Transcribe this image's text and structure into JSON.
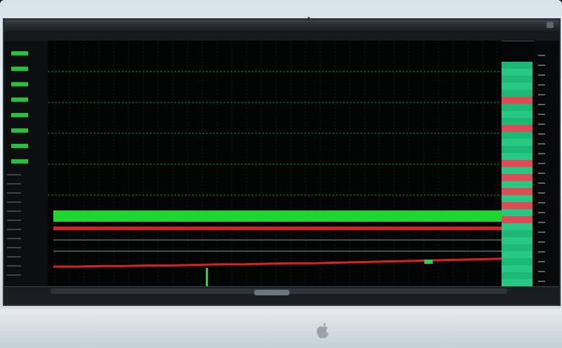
{
  "window": {
    "title": "",
    "colors": {
      "background": "#030404",
      "grid": "#1f7a3a",
      "green_band": "#1fd52f",
      "red_line": "#e1201c",
      "data_column": "#20c07a"
    }
  },
  "left_panel": {
    "rows": [
      {
        "label": "",
        "value": ""
      },
      {
        "label": "",
        "value": ""
      },
      {
        "label": "",
        "value": ""
      },
      {
        "label": "",
        "value": ""
      },
      {
        "label": "",
        "value": ""
      },
      {
        "label": "",
        "value": ""
      },
      {
        "label": "",
        "value": ""
      },
      {
        "label": "",
        "value": ""
      }
    ]
  },
  "chart_data": {
    "type": "line",
    "title": "",
    "xlabel": "",
    "ylabel": "",
    "grid": true,
    "series": [
      {
        "color": "#1fd52f",
        "values": [
          1,
          1,
          1,
          1,
          1,
          1,
          1,
          1,
          1,
          1,
          1,
          1,
          1,
          1,
          1,
          1,
          1,
          1,
          1,
          1
        ]
      },
      {
        "color": "#e1201c",
        "values": [
          0.9,
          0.9,
          0.9,
          0.9,
          0.9,
          0.9,
          0.9,
          0.9,
          0.9,
          0.9,
          0.9,
          0.9,
          0.9,
          0.9,
          0.9,
          0.9,
          0.9,
          0.9,
          0.9,
          0.9
        ]
      },
      {
        "color": "#e1201c",
        "values": [
          0.1,
          0.1,
          0.11,
          0.11,
          0.12,
          0.12,
          0.13,
          0.14,
          0.14,
          0.15,
          0.16,
          0.16,
          0.17,
          0.18,
          0.19,
          0.2,
          0.21,
          0.22,
          0.23,
          0.24
        ]
      }
    ]
  },
  "data_column": {
    "cells": [
      {
        "state": "green"
      },
      {
        "state": "green"
      },
      {
        "state": "green"
      },
      {
        "state": "green"
      },
      {
        "state": "green"
      },
      {
        "state": "red"
      },
      {
        "state": "green"
      },
      {
        "state": "green"
      },
      {
        "state": "green"
      },
      {
        "state": "red"
      },
      {
        "state": "green"
      },
      {
        "state": "green"
      },
      {
        "state": "green"
      },
      {
        "state": "green"
      },
      {
        "state": "red"
      },
      {
        "state": "green"
      },
      {
        "state": "red"
      },
      {
        "state": "green"
      },
      {
        "state": "red"
      },
      {
        "state": "green"
      },
      {
        "state": "red"
      },
      {
        "state": "green"
      },
      {
        "state": "red"
      },
      {
        "state": "green"
      },
      {
        "state": "green"
      },
      {
        "state": "green"
      },
      {
        "state": "green"
      },
      {
        "state": "green"
      },
      {
        "state": "green"
      },
      {
        "state": "green"
      },
      {
        "state": "green"
      },
      {
        "state": "green"
      }
    ]
  },
  "dock": {
    "text_left": "",
    "icon_name": "apple-logo-icon"
  },
  "status": {
    "right_text": ""
  }
}
